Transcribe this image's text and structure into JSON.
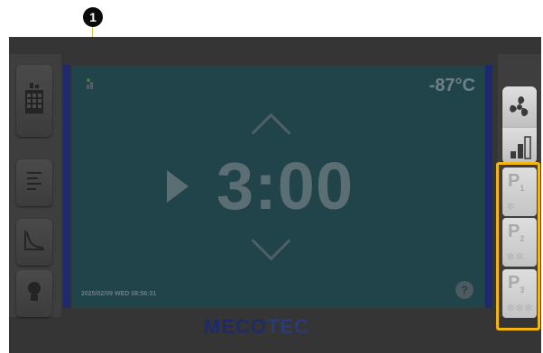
{
  "callout": {
    "number": "1"
  },
  "status": {
    "temperature": "-87°C",
    "timer": "3:00",
    "datetime": "2025/02/09 WED 08:56:31",
    "help": "?"
  },
  "logo": {
    "part1": "MECO",
    "part2": "TEC"
  },
  "programs": [
    {
      "label": "P",
      "index": "1",
      "snow": "❄"
    },
    {
      "label": "P",
      "index": "2",
      "snow": "❄❄"
    },
    {
      "label": "P",
      "index": "3",
      "snow": "❄❄❄"
    }
  ],
  "colors": {
    "accent_highlight": "#f2b60f",
    "display_bg": "#21434a",
    "brand_blue": "#1d2b6b"
  }
}
